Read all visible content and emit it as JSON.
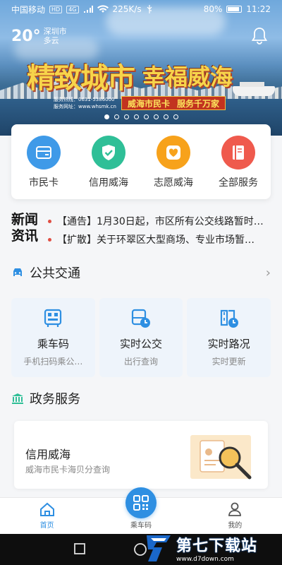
{
  "status_bar": {
    "carrier": "中国移动",
    "net_badge_1": "HD",
    "net_badge_2": "4G",
    "speed": "225K/s",
    "battery": "80%",
    "time": "11:22"
  },
  "weather": {
    "temperature": "20°",
    "city": "深圳市",
    "condition": "多云"
  },
  "banner": {
    "slogan_left": "精致城市",
    "slogan_right": "幸福威海",
    "hotline": "服务热线：0631-5386000",
    "website": "服务网址：www.whsmk.cn",
    "badge_left": "威海市民卡",
    "badge_right": "服务千万家",
    "page_count": 8,
    "active_page": 0
  },
  "quick_services": [
    {
      "label": "市民卡",
      "icon": "card-icon",
      "color": "#3f9ae8"
    },
    {
      "label": "信用威海",
      "icon": "shield-check-icon",
      "color": "#2fbf97"
    },
    {
      "label": "志愿威海",
      "icon": "heart-icon",
      "color": "#f7a21b"
    },
    {
      "label": "全部服务",
      "icon": "book-icon",
      "color": "#ef5a4d"
    }
  ],
  "news": {
    "title_line1": "新闻",
    "title_line2": "资讯",
    "items": [
      "【通告】1月30日起，市区所有公交线路暂时…",
      "【扩散】关于环翠区大型商场、专业市场暂…"
    ]
  },
  "transport": {
    "title": "公共交通",
    "cards": [
      {
        "name": "乘车码",
        "sub": "手机扫码乘公…",
        "icon": "bus-qr-icon"
      },
      {
        "name": "实时公交",
        "sub": "出行查询",
        "icon": "bus-clock-icon"
      },
      {
        "name": "实时路况",
        "sub": "实时更新",
        "icon": "road-clock-icon"
      }
    ]
  },
  "gov": {
    "title": "政务服务",
    "card_title": "信用威海",
    "card_sub": "威海市民卡海贝分查询"
  },
  "tabbar": {
    "home": "首页",
    "ride_code": "乘车码",
    "mine": "我的"
  },
  "watermark": {
    "name": "第七下载站",
    "url": "www.d7down.com"
  },
  "colors": {
    "accent": "#2e8fe2",
    "news_dot": "#e04e43"
  }
}
